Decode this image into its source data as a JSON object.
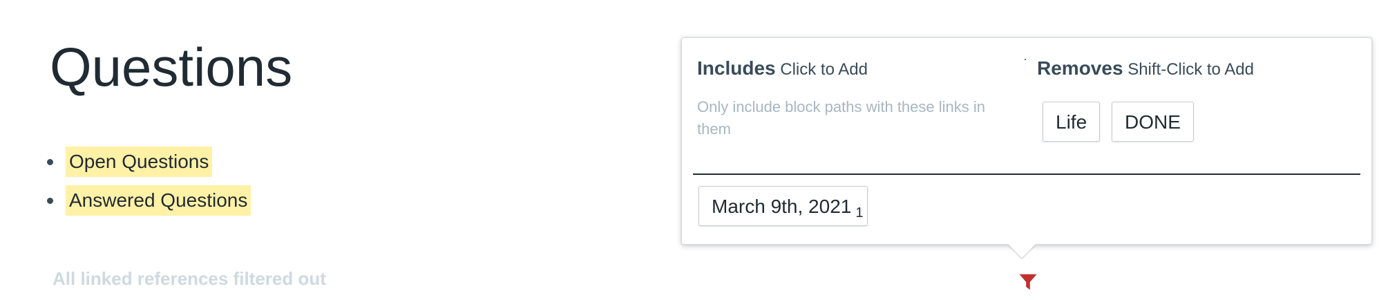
{
  "page": {
    "title": "Questions",
    "children": [
      {
        "label": "Open Questions"
      },
      {
        "label": "Answered Questions"
      }
    ],
    "references_message": "All linked references filtered out"
  },
  "filter_popover": {
    "includes": {
      "title": "Includes",
      "hint": "Click to Add",
      "description": "Only include block paths with these links in them"
    },
    "removes": {
      "title": "Removes",
      "hint": "Shift-Click to Add",
      "tags": [
        {
          "label": "Life"
        },
        {
          "label": "DONE"
        }
      ]
    },
    "available_tags": [
      {
        "label": "March 9th, 2021",
        "count": "1"
      }
    ]
  },
  "icons": {
    "filter": "filter-icon"
  },
  "colors": {
    "highlight": "#fff1a6",
    "filter_active": "#c23030",
    "muted_text": "#a7b6c2"
  }
}
